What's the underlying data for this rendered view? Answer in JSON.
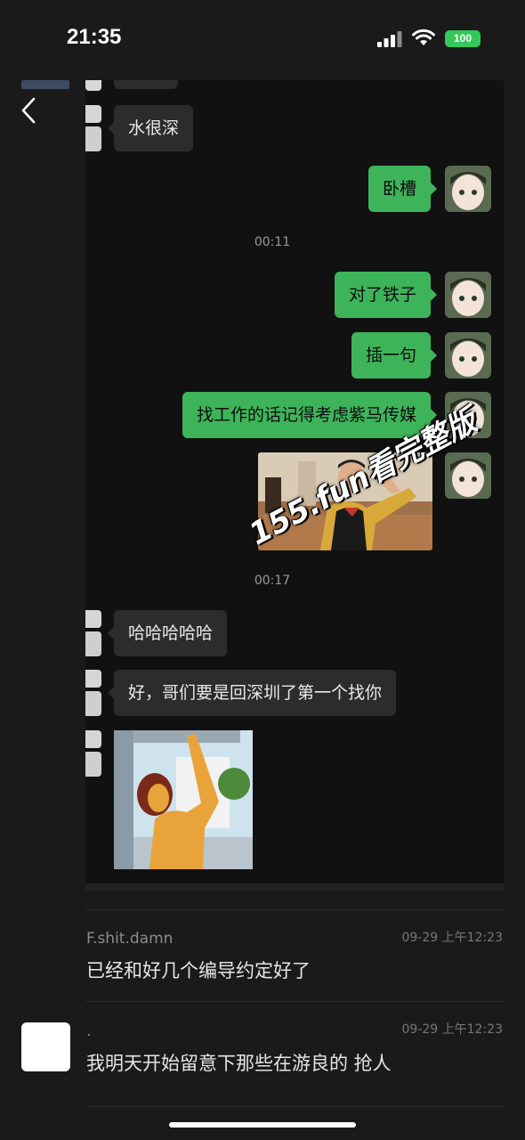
{
  "status_bar": {
    "time": "21:35",
    "battery": "100"
  },
  "chat": {
    "messages": [
      {
        "side": "left",
        "text": "水很深"
      },
      {
        "side": "right",
        "text": "卧槽"
      },
      {
        "type": "time",
        "text": "00:11"
      },
      {
        "side": "right",
        "text": "对了铁子"
      },
      {
        "side": "right",
        "text": "插一句"
      },
      {
        "side": "right",
        "text": "找工作的话记得考虑紫马传媒"
      },
      {
        "side": "right",
        "type": "image",
        "icon": "photo-man-saluting"
      },
      {
        "type": "time",
        "text": "00:17"
      },
      {
        "side": "left",
        "text": "哈哈哈哈哈"
      },
      {
        "side": "left",
        "text": "好，哥们要是回深圳了第一个找你"
      },
      {
        "side": "left",
        "type": "image",
        "icon": "cartoon-sticker"
      }
    ]
  },
  "watermark": "155.fun看完整版",
  "comments": [
    {
      "name": "F.shit.damn",
      "time": "09-29 上午12:23",
      "text": "已经和好几个编导约定好了"
    },
    {
      "name": ".",
      "time": "09-29 上午12:23",
      "text": "我明天开始留意下那些在游良的 抢人"
    }
  ],
  "colors": {
    "sent_bubble": "#3eb45a",
    "received_bubble": "#2c2c2c",
    "background": "#1a1a1a"
  }
}
